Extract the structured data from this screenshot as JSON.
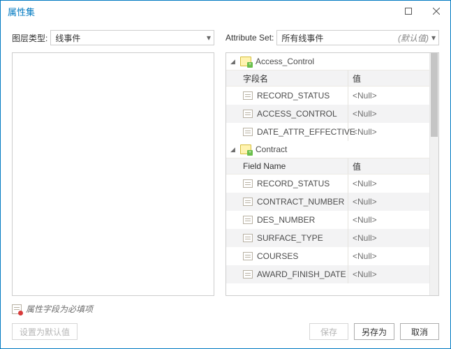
{
  "window": {
    "title": "属性集"
  },
  "filters": {
    "layer_type_label": "图层类型:",
    "layer_type_value": "线事件",
    "attr_set_label": "Attribute Set:",
    "attr_set_value": "所有线事件",
    "attr_set_default": "(默认值)"
  },
  "groups": [
    {
      "name": "Access_Control",
      "col_field": "字段名",
      "col_value": "值",
      "rows": [
        {
          "field": "RECORD_STATUS",
          "value": "<Null>"
        },
        {
          "field": "ACCESS_CONTROL",
          "value": "<Null>"
        },
        {
          "field": "DATE_ATTR_EFFECTIVE",
          "value": "<Null>"
        }
      ]
    },
    {
      "name": "Contract",
      "col_field": "Field Name",
      "col_value": "值",
      "rows": [
        {
          "field": "RECORD_STATUS",
          "value": "<Null>"
        },
        {
          "field": "CONTRACT_NUMBER",
          "value": "<Null>"
        },
        {
          "field": "DES_NUMBER",
          "value": "<Null>"
        },
        {
          "field": "SURFACE_TYPE",
          "value": "<Null>"
        },
        {
          "field": "COURSES",
          "value": "<Null>"
        },
        {
          "field": "AWARD_FINISH_DATE",
          "value": "<Null>"
        }
      ]
    }
  ],
  "footer": {
    "note": "属性字段为必填项",
    "set_default": "设置为默认值",
    "save": "保存",
    "save_as": "另存为",
    "cancel": "取消"
  }
}
